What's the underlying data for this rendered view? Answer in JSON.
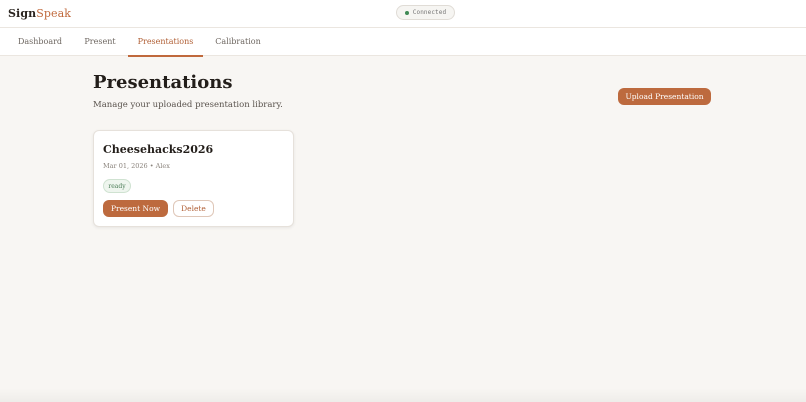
{
  "app": {
    "brand_part1": "Sign",
    "brand_part2": "Speak",
    "connection_status": "Connected",
    "brand_color": "#c0693c",
    "status_color": "#3f8a55"
  },
  "nav": {
    "tabs": [
      {
        "label": "Dashboard",
        "active": false
      },
      {
        "label": "Present",
        "active": false
      },
      {
        "label": "Presentations",
        "active": true
      },
      {
        "label": "Calibration",
        "active": false
      }
    ]
  },
  "page": {
    "title": "Presentations",
    "subtitle": "Manage your uploaded presentation library.",
    "upload_label": "Upload Presentation"
  },
  "presentations": [
    {
      "title": "Cheesehacks2026",
      "meta": "Mar 01, 2026 • Alex",
      "status": "ready",
      "present_label": "Present Now",
      "delete_label": "Delete"
    }
  ]
}
